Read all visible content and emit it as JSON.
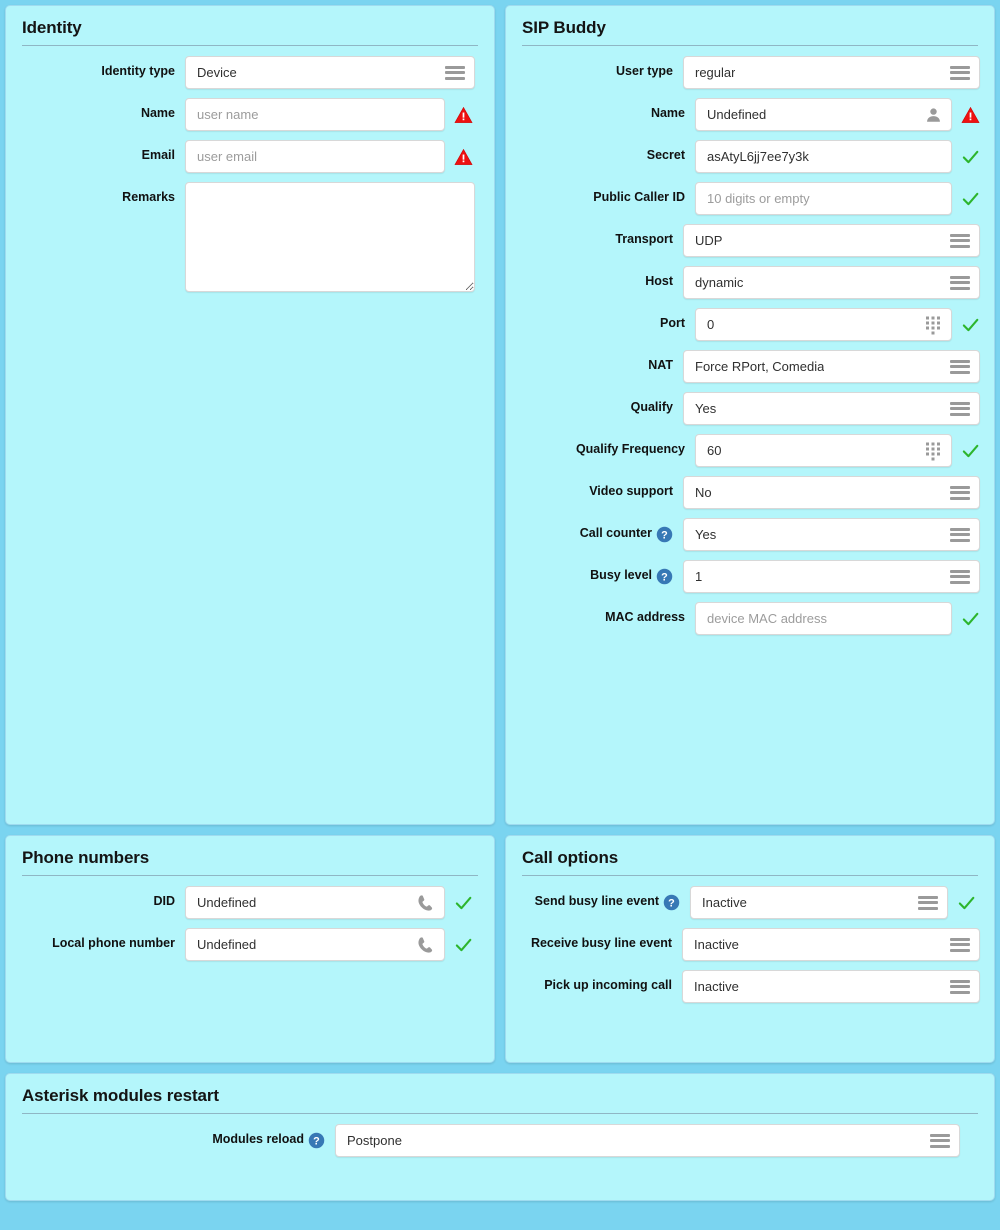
{
  "colors": {
    "page_background": "#7ad4f0",
    "panel_background": "#b4f6fb",
    "panel_border": "#9fdbef",
    "warning": "#ee1111",
    "valid": "#2db52d",
    "help": "#3778b5"
  },
  "panels": {
    "identity": {
      "title": "Identity",
      "fields": {
        "identity_type": {
          "label": "Identity type",
          "value": "Device",
          "control": "select",
          "icon": "hamburger-icon"
        },
        "name": {
          "label": "Name",
          "placeholder": "user name",
          "value": "",
          "control": "input",
          "status": "warning"
        },
        "email": {
          "label": "Email",
          "placeholder": "user email",
          "value": "",
          "control": "input",
          "status": "warning"
        },
        "remarks": {
          "label": "Remarks",
          "value": "",
          "placeholder": "",
          "control": "textarea"
        }
      }
    },
    "sip_buddy": {
      "title": "SIP Buddy",
      "fields": {
        "user_type": {
          "label": "User type",
          "value": "regular",
          "control": "select",
          "icon": "hamburger-icon"
        },
        "name": {
          "label": "Name",
          "value": "Undefined",
          "control": "input",
          "inner_icon": "person-icon",
          "status": "warning"
        },
        "secret": {
          "label": "Secret",
          "value": "asAtyL6jj7ee7y3k",
          "control": "input",
          "status": "valid"
        },
        "public_caller_id": {
          "label": "Public Caller ID",
          "placeholder": "10 digits or empty",
          "value": "",
          "control": "input",
          "status": "valid"
        },
        "transport": {
          "label": "Transport",
          "value": "UDP",
          "control": "select",
          "icon": "hamburger-icon"
        },
        "host": {
          "label": "Host",
          "value": "dynamic",
          "control": "select",
          "icon": "hamburger-icon"
        },
        "port": {
          "label": "Port",
          "value": "0",
          "control": "input",
          "inner_icon": "dialpad-icon",
          "status": "valid"
        },
        "nat": {
          "label": "NAT",
          "value": "Force RPort, Comedia",
          "control": "select",
          "icon": "hamburger-icon"
        },
        "qualify": {
          "label": "Qualify",
          "value": "Yes",
          "control": "select",
          "icon": "hamburger-icon"
        },
        "qualify_frequency": {
          "label": "Qualify Frequency",
          "value": "60",
          "control": "input",
          "inner_icon": "dialpad-icon",
          "status": "valid"
        },
        "video_support": {
          "label": "Video support",
          "value": "No",
          "control": "select",
          "icon": "hamburger-icon"
        },
        "call_counter": {
          "label": "Call counter",
          "value": "Yes",
          "control": "select",
          "icon": "hamburger-icon",
          "help": "help-icon"
        },
        "busy_level": {
          "label": "Busy level",
          "value": "1",
          "control": "select",
          "icon": "hamburger-icon",
          "help": "help-icon"
        },
        "mac_address": {
          "label": "MAC address",
          "placeholder": "device MAC address",
          "value": "",
          "control": "input",
          "status": "valid"
        }
      }
    },
    "phone_numbers": {
      "title": "Phone numbers",
      "fields": {
        "did": {
          "label": "DID",
          "value": "Undefined",
          "control": "input",
          "inner_icon": "phone-icon",
          "status": "valid"
        },
        "local_phone_number": {
          "label": "Local phone number",
          "value": "Undefined",
          "control": "input",
          "inner_icon": "phone-icon",
          "status": "valid"
        }
      }
    },
    "call_options": {
      "title": "Call options",
      "fields": {
        "send_busy_line_event": {
          "label": "Send busy line event",
          "value": "Inactive",
          "control": "select",
          "icon": "hamburger-icon",
          "help": "help-icon",
          "status": "valid"
        },
        "receive_busy_line_event": {
          "label": "Receive busy line event",
          "value": "Inactive",
          "control": "select",
          "icon": "hamburger-icon"
        },
        "pick_up_incoming_call": {
          "label": "Pick up incoming call",
          "value": "Inactive",
          "control": "select",
          "icon": "hamburger-icon"
        }
      }
    },
    "asterisk_modules_restart": {
      "title": "Asterisk modules restart",
      "fields": {
        "modules_reload": {
          "label": "Modules reload",
          "value": "Postpone",
          "control": "select",
          "icon": "hamburger-icon",
          "help": "help-icon"
        }
      }
    }
  }
}
